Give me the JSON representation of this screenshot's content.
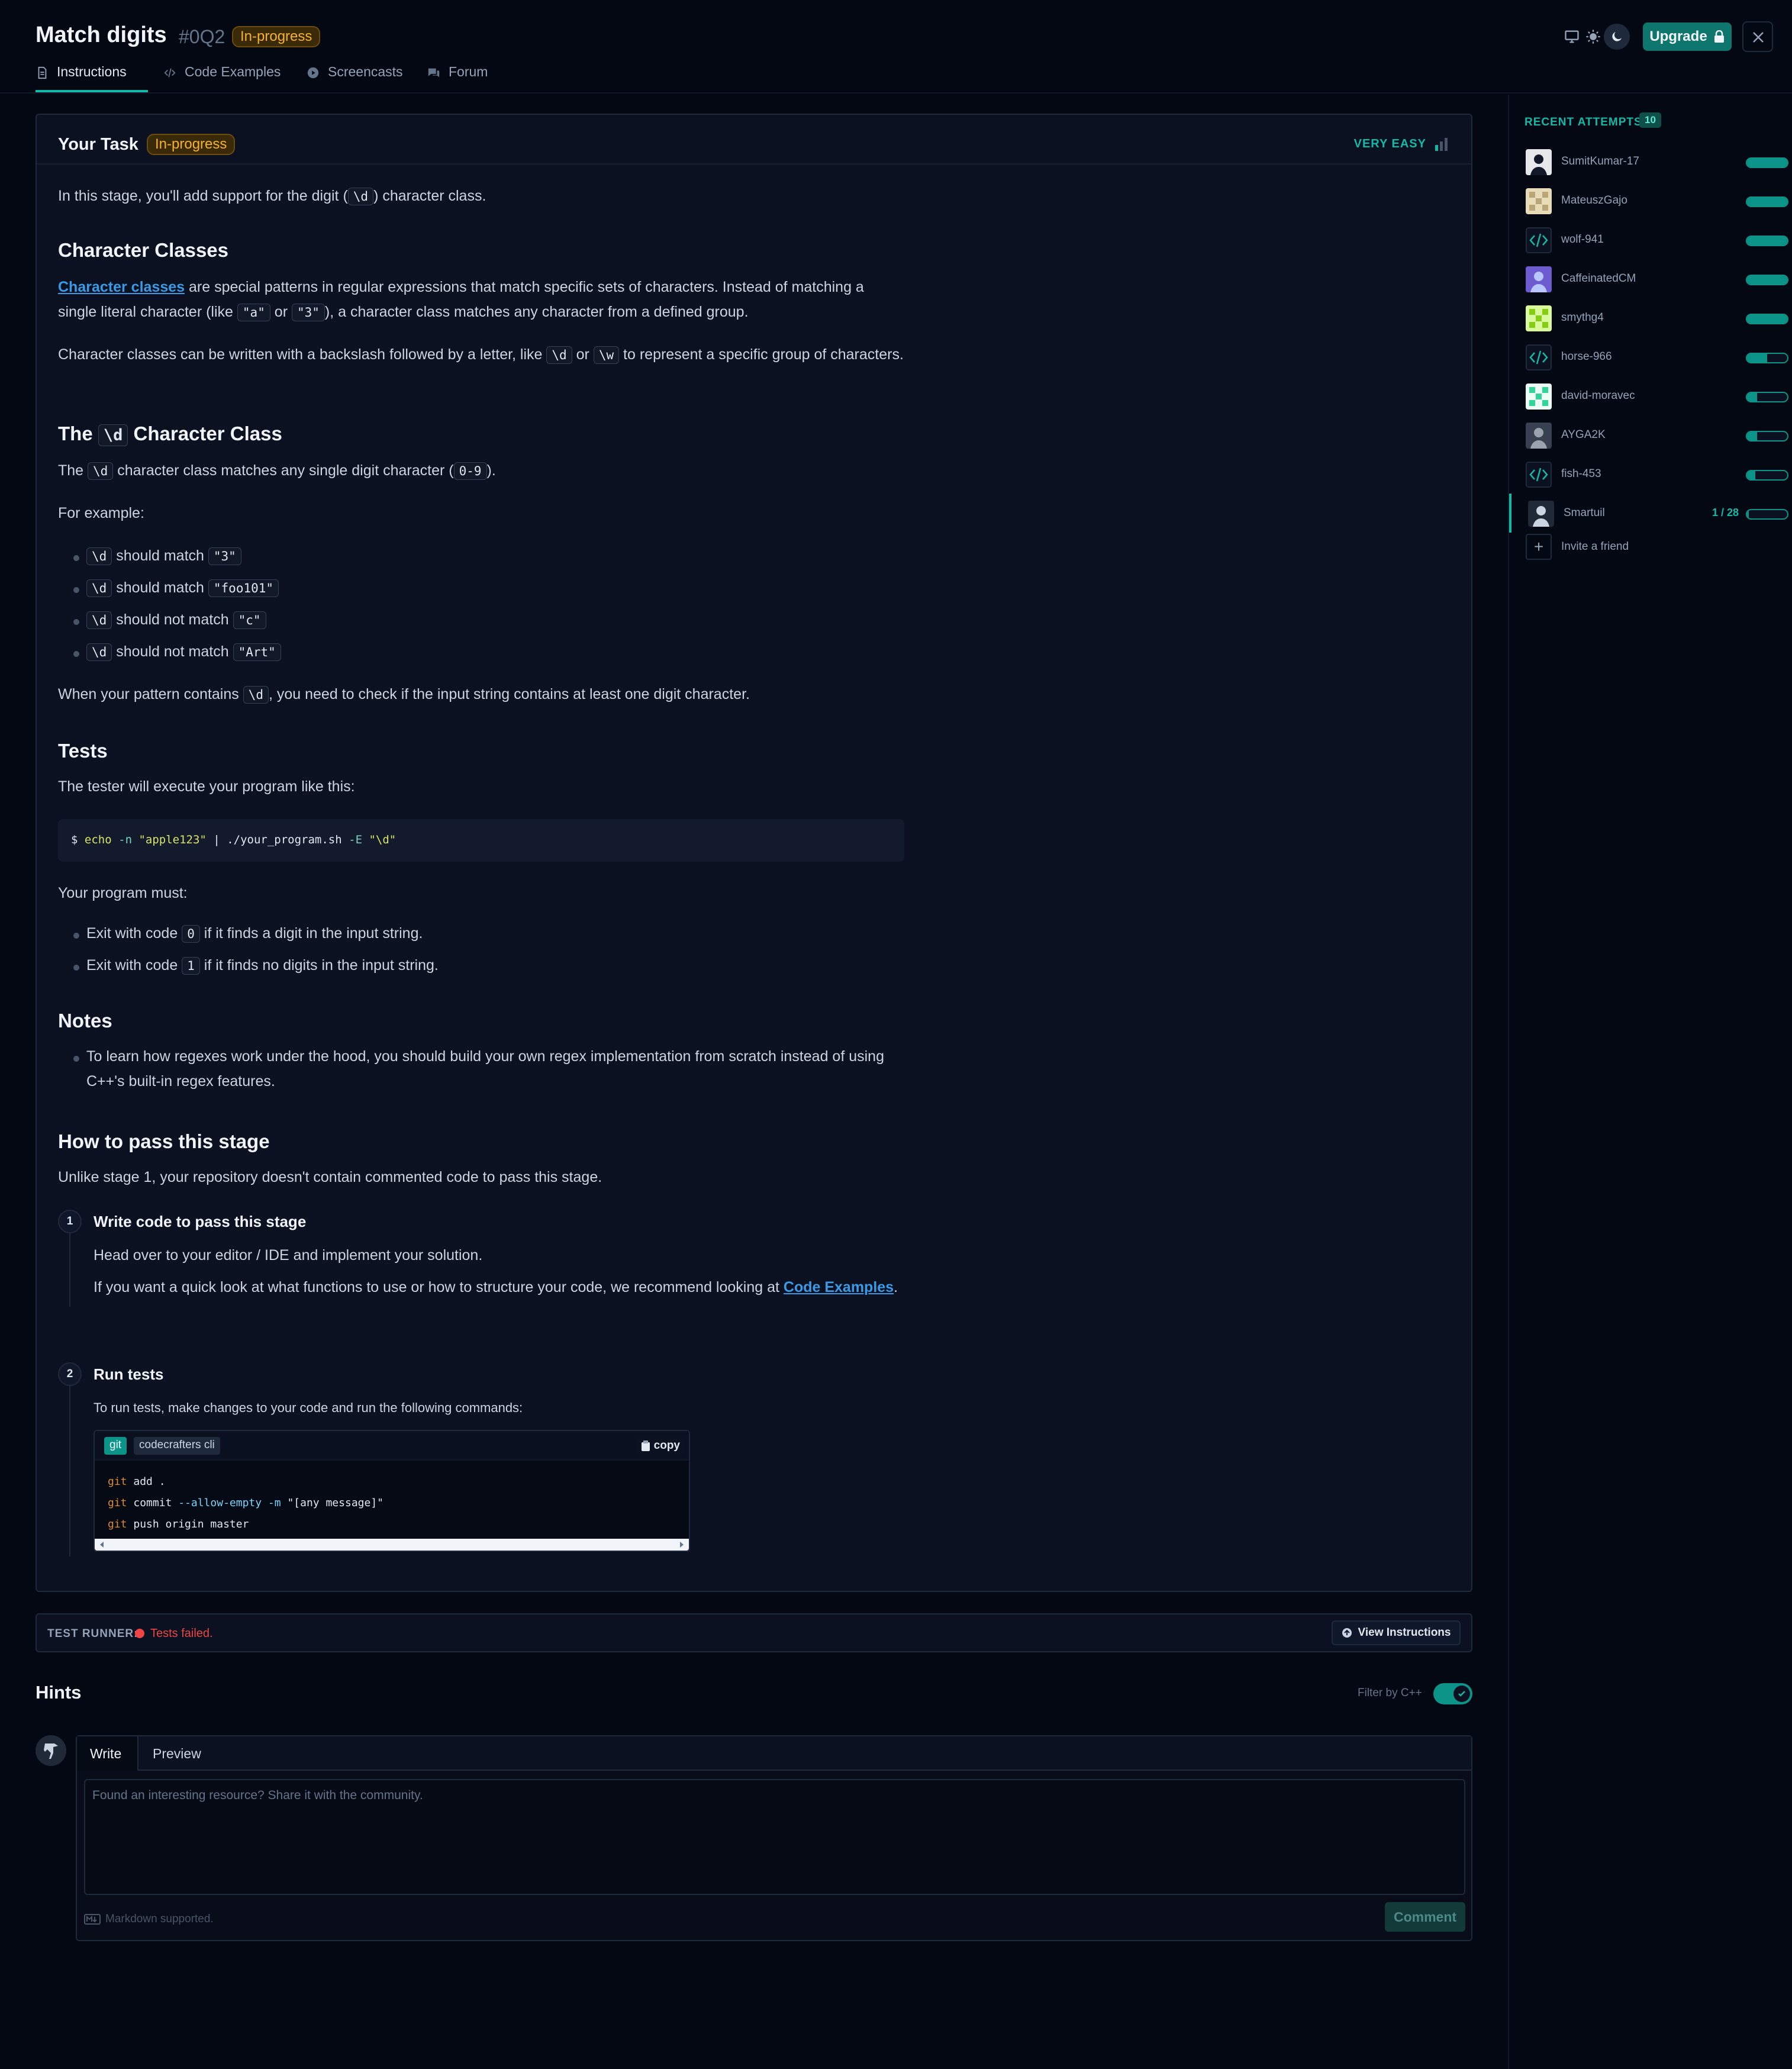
{
  "header": {
    "title": "Match digits",
    "stage_num": "#0Q2",
    "status_badge": "In-progress",
    "upgrade_label": "Upgrade",
    "tabs": [
      {
        "label": "Instructions",
        "icon": "document-icon",
        "active": true
      },
      {
        "label": "Code Examples",
        "icon": "code-icon",
        "active": false
      },
      {
        "label": "Screencasts",
        "icon": "play-icon",
        "active": false
      },
      {
        "label": "Forum",
        "icon": "chat-icon",
        "active": false
      }
    ]
  },
  "task": {
    "heading": "Your Task",
    "badge": "In-progress",
    "difficulty": "VERY EASY",
    "intro": {
      "pre": "In this stage, you'll add support for the digit (",
      "code": "\\d",
      "post": ") character class."
    },
    "section1_title": "Character Classes",
    "s1_p1": {
      "link": "Character classes",
      "t1": " are special patterns in regular expressions that match specific sets of characters. Instead of matching a single literal character (like ",
      "c1": "\"a\"",
      "t2": " or ",
      "c2": "\"3\"",
      "t3": "), a character class matches any character from a defined group."
    },
    "s1_p2": {
      "t1": "Character classes can be written with a backslash followed by a letter, like ",
      "c1": "\\d",
      "t2": " or ",
      "c2": "\\w",
      "t3": " to represent a specific group of characters."
    },
    "section2_title": {
      "pre": "The ",
      "code": "\\d",
      "post": " Character Class"
    },
    "s2_p1": {
      "t1": "The ",
      "c1": "\\d",
      "t2": " character class matches any single digit character (",
      "c2": "0-9",
      "t3": ")."
    },
    "for_example": "For example:",
    "examples": [
      {
        "code": "\\d",
        "verb": " should match ",
        "value": "\"3\""
      },
      {
        "code": "\\d",
        "verb": " should match ",
        "value": "\"foo101\""
      },
      {
        "code": "\\d",
        "verb": " should not match ",
        "value": "\"c\""
      },
      {
        "code": "\\d",
        "verb": " should not match ",
        "value": "\"Art\""
      }
    ],
    "s2_p2": {
      "t1": "When your pattern contains ",
      "c1": "\\d",
      "t2": ", you need to check if the input string contains at least one digit character."
    },
    "tests_title": "Tests",
    "tests_intro": "The tester will execute your program like this:",
    "command": {
      "prompt": "$",
      "echo": "echo",
      "flag": "-n",
      "arg": "\"apple123\"",
      "pipe": "|",
      "prog": "./your_program.sh",
      "eflag": "-E",
      "pattern": "\"\\d\""
    },
    "must_intro": "Your program must:",
    "must_items": [
      {
        "t1": "Exit with code ",
        "code": "0",
        "t2": " if it finds a digit in the input string."
      },
      {
        "t1": "Exit with code ",
        "code": "1",
        "t2": " if it finds no digits in the input string."
      }
    ],
    "notes_title": "Notes",
    "notes_items": [
      "To learn how regexes work under the hood, you should build your own regex implementation from scratch instead of using C++'s built-in regex features."
    ],
    "how_title": "How to pass this stage",
    "how_intro": "Unlike stage 1, your repository doesn't contain commented code to pass this stage.",
    "steps": [
      {
        "num": "1",
        "title": "Write code to pass this stage",
        "p1": "Head over to your editor / IDE and implement your solution.",
        "p2_pre": "If you want a quick look at what functions to use or how to structure your code, we recommend looking at ",
        "p2_link": "Code Examples",
        "p2_post": "."
      },
      {
        "num": "2",
        "title": "Run tests",
        "p1": "To run tests, make changes to your code and run the following commands:"
      }
    ],
    "cli": {
      "tab_git": "git",
      "tab_cli": "codecrafters cli",
      "copy_label": "copy",
      "line1": {
        "cmd": "git",
        "rest": " add ."
      },
      "line2": {
        "cmd": "git",
        "sub": " commit",
        "flag": " --allow-empty -m",
        "str": " \"[any message]\""
      },
      "line3": {
        "cmd": "git",
        "rest": " push origin master"
      }
    }
  },
  "test_runner": {
    "label": "TEST RUNNER:",
    "status": "Tests failed.",
    "status_color": "#ef4444",
    "view_instructions": "View Instructions"
  },
  "hints": {
    "title": "Hints",
    "filter_label": "Filter by C++",
    "filter_on": true,
    "tab_write": "Write",
    "tab_preview": "Preview",
    "placeholder": "Found an interesting resource? Share it with the community.",
    "markdown_note": "Markdown supported.",
    "comment_button": "Comment"
  },
  "sidebar": {
    "title": "RECENT ATTEMPTS",
    "count": "10",
    "attempts": [
      {
        "name": "SumitKumar-17",
        "progress": 1.0
      },
      {
        "name": "MateuszGajo",
        "progress": 1.0
      },
      {
        "name": "wolf-941",
        "progress": 1.0
      },
      {
        "name": "CaffeinatedCM",
        "progress": 1.0
      },
      {
        "name": "smythg4",
        "progress": 1.0
      },
      {
        "name": "horse-966",
        "progress": 0.5
      },
      {
        "name": "david-moravec",
        "progress": 0.25
      },
      {
        "name": "AYGA2K",
        "progress": 0.25
      },
      {
        "name": "fish-453",
        "progress": 0.2
      },
      {
        "name": "Smartuil",
        "progress": 0.04,
        "progress_text": "1 / 28",
        "current": true
      }
    ],
    "invite_label": "Invite a friend"
  },
  "colors": {
    "accent": "#14b8a6",
    "orange_badge": "#f5b133",
    "link": "#3b9ae6",
    "error": "#ef4444"
  }
}
